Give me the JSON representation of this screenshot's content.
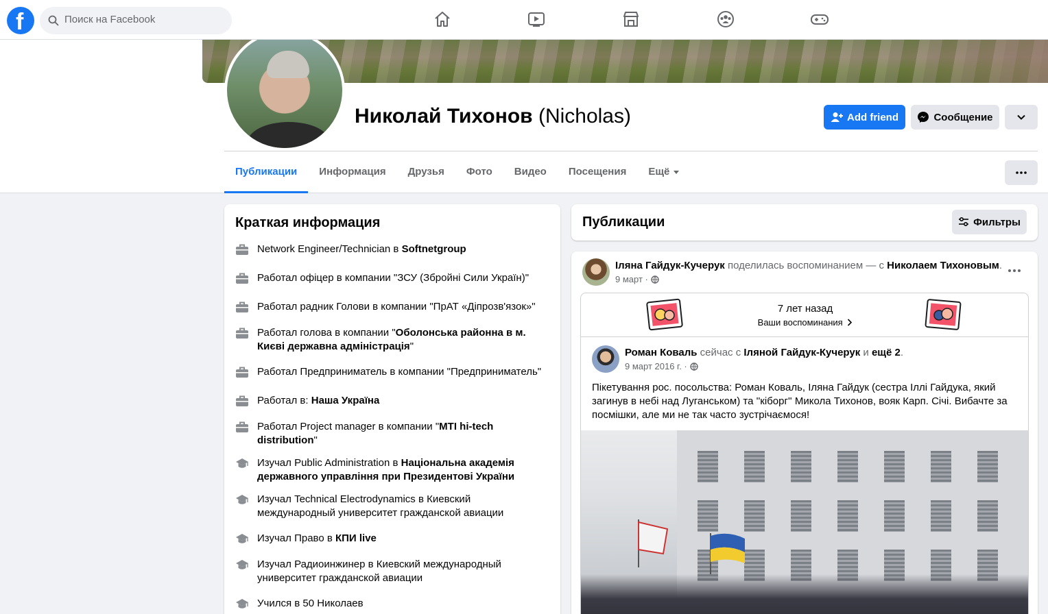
{
  "topbar": {
    "logo": "facebook-logo",
    "search_placeholder": "Поиск на Facebook",
    "nav_icons": [
      "home-icon",
      "watch-icon",
      "marketplace-icon",
      "groups-icon",
      "gaming-icon"
    ]
  },
  "profile": {
    "name": "Николай Тихонов",
    "alt_name": "(Nicholas)",
    "buttons": {
      "add_friend": "Add friend",
      "message": "Сообщение"
    },
    "tabs": [
      "Публикации",
      "Информация",
      "Друзья",
      "Фото",
      "Видео",
      "Посещения",
      "Ещё"
    ],
    "active_tab": "Публикации"
  },
  "intro": {
    "title": "Краткая информация",
    "items": [
      {
        "icon": "briefcase-icon",
        "prefix": "Network Engineer/Technician в ",
        "strong": "Softnetgroup",
        "suffix": ""
      },
      {
        "icon": "briefcase-icon",
        "prefix": "Работал офіцер в компании \"ЗСУ (Збройні Сили Україн)\"",
        "strong": "",
        "suffix": ""
      },
      {
        "icon": "briefcase-icon",
        "prefix": "Работал радник Голови в компании \"ПрАТ «Діпрозв'язок»\"",
        "strong": "",
        "suffix": ""
      },
      {
        "icon": "briefcase-icon",
        "prefix": "Работал голова в компании \"",
        "strong": "Оболонська районна в м. Києві державна адміністрація",
        "suffix": "\""
      },
      {
        "icon": "briefcase-icon",
        "prefix": "Работал Предприниматель в компании \"Предприниматель\"",
        "strong": "",
        "suffix": ""
      },
      {
        "icon": "briefcase-icon",
        "prefix": "Работал в: ",
        "strong": "Наша Україна",
        "suffix": ""
      },
      {
        "icon": "briefcase-icon",
        "prefix": "Работал Project manager в компании \"",
        "strong": "MTI hi-tech distribution",
        "suffix": "\""
      },
      {
        "icon": "graduation-cap-icon",
        "prefix": "Изучал Public Administration в ",
        "strong": "Національна академія державного управління при Президентові України",
        "suffix": ""
      },
      {
        "icon": "graduation-cap-icon",
        "prefix": "Изучал Technical Electrodynamics в Киевский международный университет гражданской авиации",
        "strong": "",
        "suffix": ""
      },
      {
        "icon": "graduation-cap-icon",
        "prefix": "Изучал Право в ",
        "strong": "КПИ live",
        "suffix": ""
      },
      {
        "icon": "graduation-cap-icon",
        "prefix": "Изучал Радиоинжинер в Киевский международный университет гражданской авиации",
        "strong": "",
        "suffix": ""
      },
      {
        "icon": "graduation-cap-icon",
        "prefix": "Учился в 50 Николаев",
        "strong": "",
        "suffix": ""
      }
    ]
  },
  "posts": {
    "title": "Публикации",
    "filters_label": "Фильтры",
    "post": {
      "author": "Іляна Гайдук-Кучерук",
      "action": " поделилась воспоминанием — с ",
      "tagged": "Николаем Тихоновым",
      "end": ".",
      "date": "9 март ·",
      "memory": {
        "years": "7 лет назад",
        "link": "Ваши воспоминания"
      },
      "inner": {
        "author": "Роман Коваль",
        "with_text": " сейчас с ",
        "tagged": "Іляной Гайдук-Кучерук",
        "and_text": " и ",
        "others": "ещё 2",
        "end": ".",
        "date": "9 март 2016 г. ·",
        "text": "Пікетування рос. посольства: Роман Коваль, Іляна Гайдук (сестра Іллі Гайдука, який загинув в небі над Луганськом) та ''кіборг'' Микола Тихонов, вояк Карп. Січі. Вибачте за посмішки, але ми не так часто зустрічаємося!"
      }
    }
  },
  "colors": {
    "accent": "#1877f2",
    "secondary_text": "#65676b",
    "button_gray": "#e4e6eb",
    "page_bg": "#f0f2f5"
  }
}
